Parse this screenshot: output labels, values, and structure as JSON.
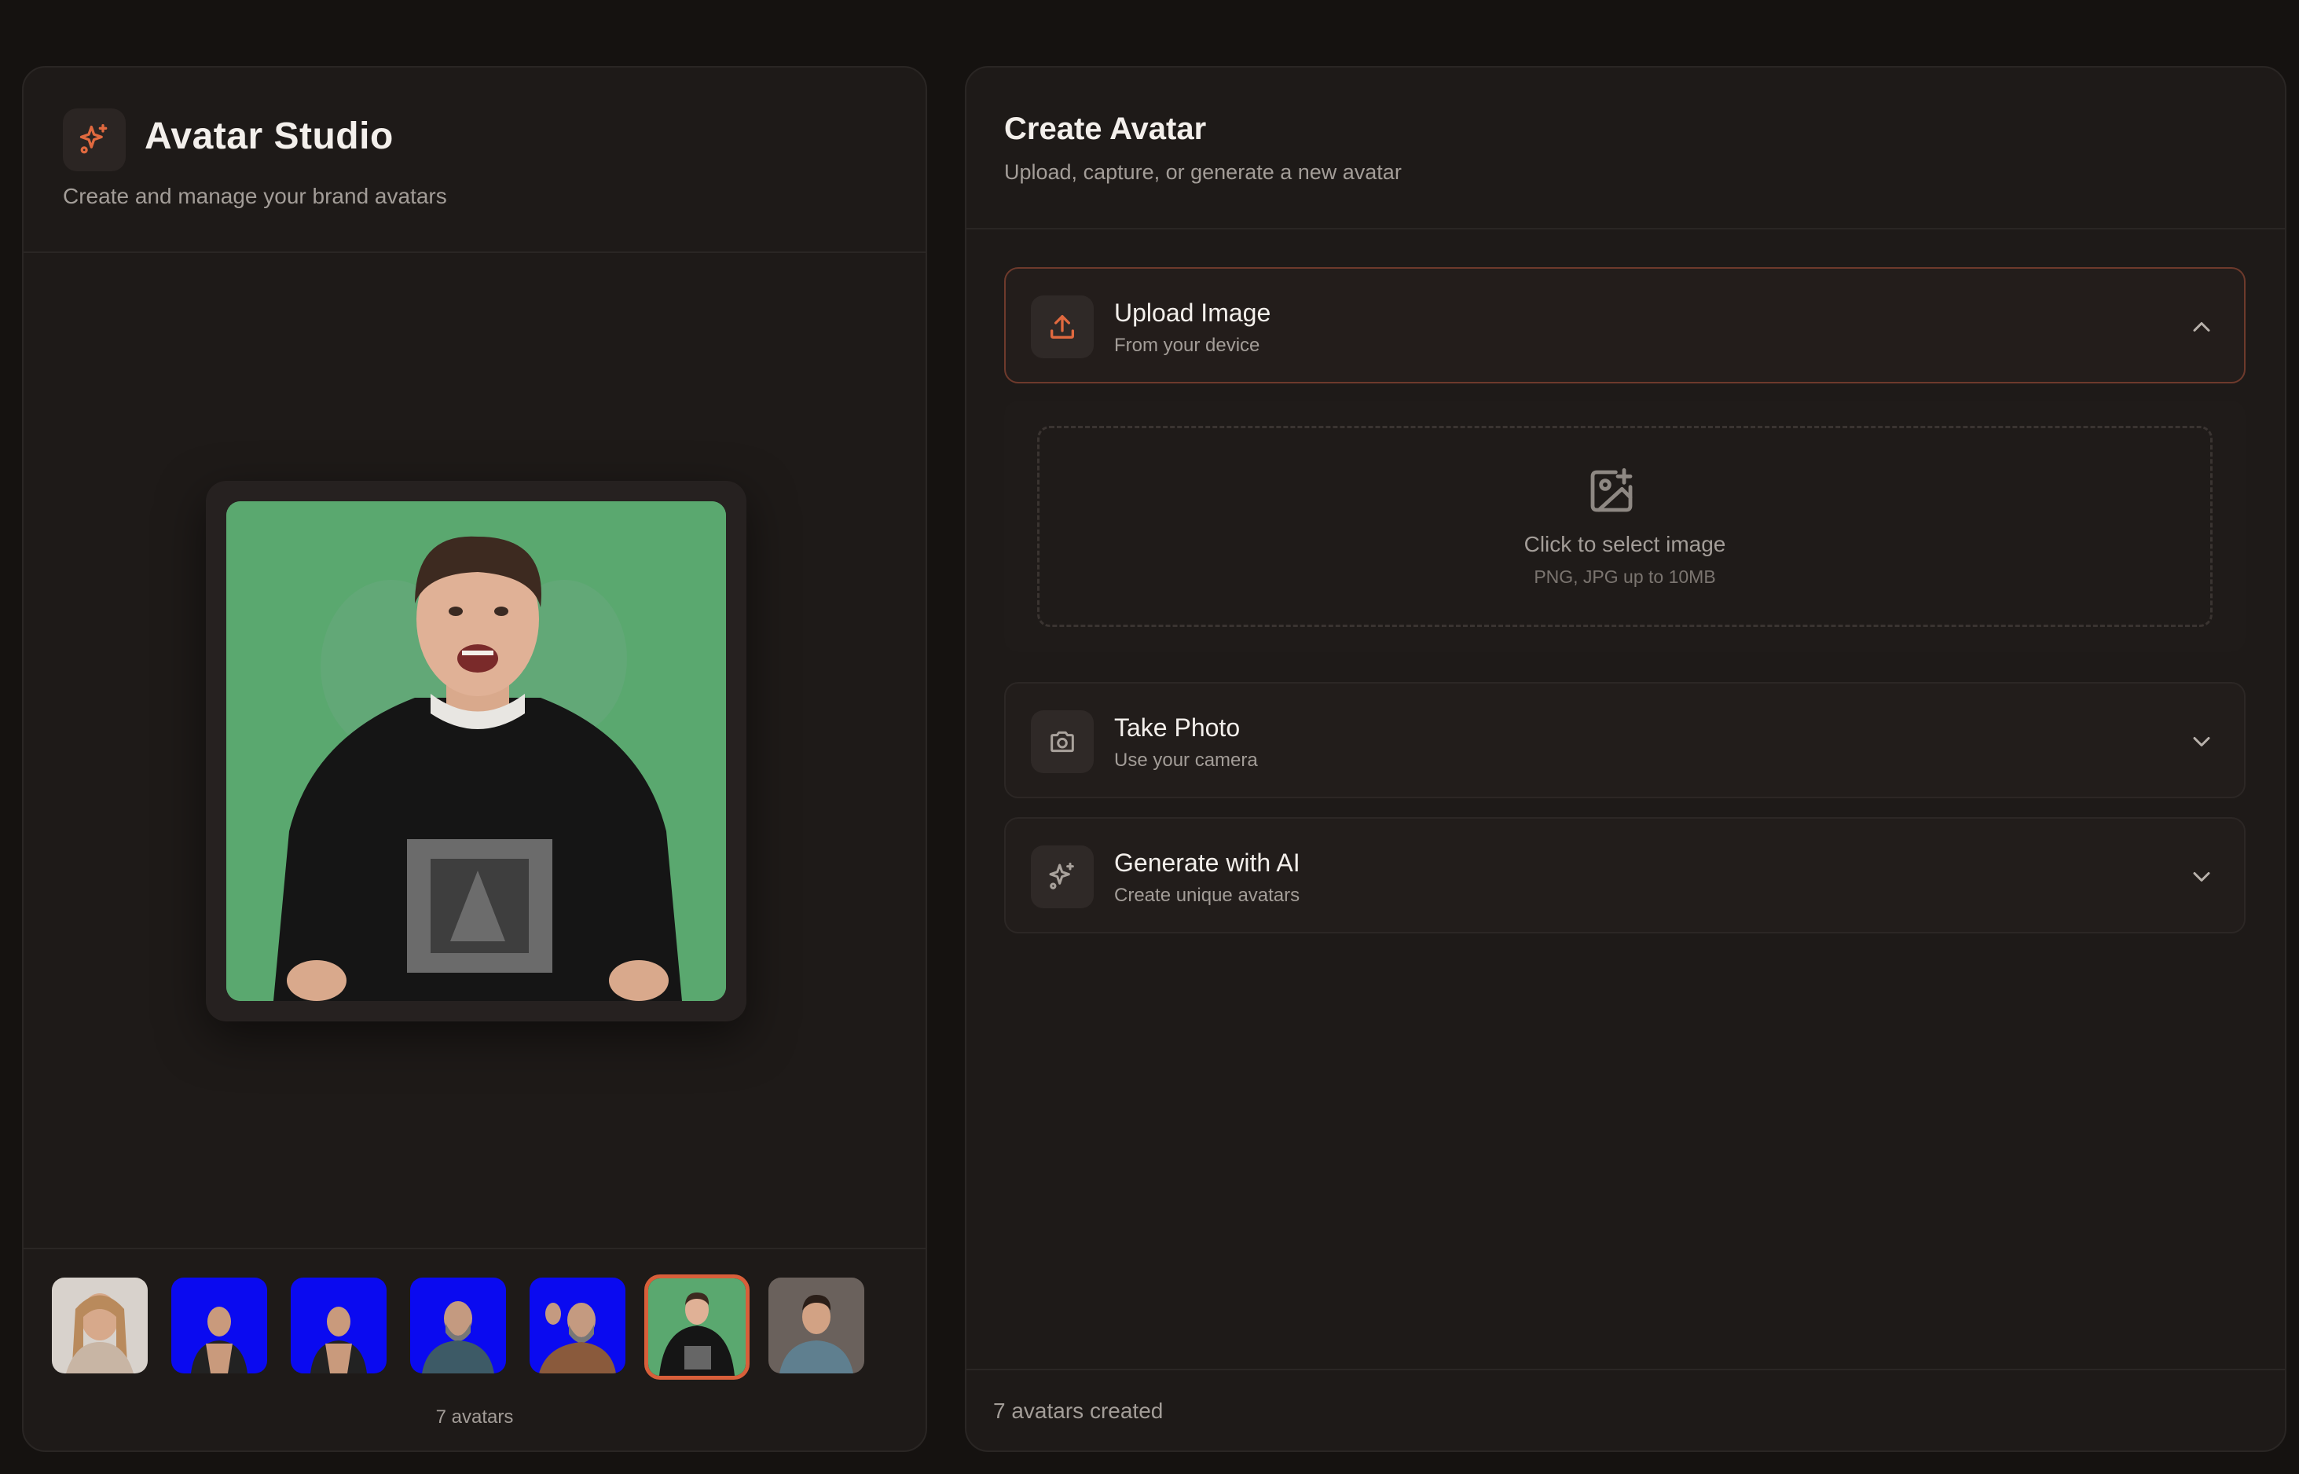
{
  "app": {
    "title": "Avatar Studio",
    "subtitle": "Create and manage your brand avatars",
    "logo_icon": "sparkles-icon",
    "accent_color": "#e0693f"
  },
  "gallery": {
    "count_label": "7 avatars",
    "selected_index": 5,
    "thumbnails": [
      {
        "name": "avatar-woman-light-background",
        "background": "#d8d2cc"
      },
      {
        "name": "avatar-man-tank-top-blue-screen",
        "background": "#0a0af0"
      },
      {
        "name": "avatar-man-tank-top-blue-screen-2",
        "background": "#0a0af0"
      },
      {
        "name": "avatar-bearded-man-blue-screen",
        "background": "#0a0af0"
      },
      {
        "name": "avatar-bearded-man-pointing-blue-screen",
        "background": "#0a0af0"
      },
      {
        "name": "avatar-man-hoodie-green-screen",
        "background": "#5aa86f"
      },
      {
        "name": "avatar-man-smiling-studio",
        "background": "#6a615c"
      }
    ]
  },
  "create": {
    "title": "Create Avatar",
    "subtitle": "Upload, capture, or generate a new avatar",
    "sections": [
      {
        "title": "Upload Image",
        "subtitle": "From your device",
        "icon": "upload-icon",
        "expanded": true
      },
      {
        "title": "Take Photo",
        "subtitle": "Use your camera",
        "icon": "camera-icon",
        "expanded": false
      },
      {
        "title": "Generate with AI",
        "subtitle": "Create unique avatars",
        "icon": "sparkles-icon",
        "expanded": false
      }
    ],
    "upload": {
      "prompt": "Click to select image",
      "hint": "PNG, JPG up to 10MB",
      "icon": "image-plus-icon"
    },
    "footer": "7 avatars created"
  }
}
